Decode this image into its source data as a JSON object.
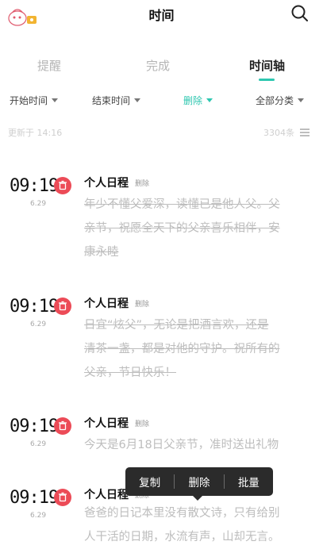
{
  "header": {
    "title": "时间",
    "search_icon": "search-icon",
    "avatar_icon": "cartoon-avatar-icon"
  },
  "tabs": [
    {
      "label": "提醒",
      "active": false
    },
    {
      "label": "完成",
      "active": false
    },
    {
      "label": "时间轴",
      "active": true
    }
  ],
  "filters": [
    {
      "label": "开始时间"
    },
    {
      "label": "结束时间"
    },
    {
      "label": "删除",
      "accent": true
    },
    {
      "label": "全部分类"
    }
  ],
  "status": {
    "updated": "更新于 14:16",
    "count": "3304条",
    "list_icon": "list-icon"
  },
  "entries": [
    {
      "time": "09:19",
      "date": "6.29",
      "category": "个人日程",
      "tag": "删除",
      "lines": [
        "年少不懂父爱深，读懂已是他人父。父",
        "亲节，祝愿全天下的父亲喜乐相伴，安",
        "康永睦"
      ],
      "struck": true
    },
    {
      "time": "09:19",
      "date": "6.29",
      "category": "个人日程",
      "tag": "删除",
      "lines": [
        "日宜“炫父”，无论是把酒言欢，还是",
        "清茶一盏，都是对他的守护。祝所有的",
        "父亲，节日快乐！"
      ],
      "struck": true
    },
    {
      "time": "09:19",
      "date": "6.29",
      "category": "个人日程",
      "tag": "删除",
      "lines": [
        "今天是6月18日父亲节，准时送出礼物"
      ],
      "struck": false
    },
    {
      "time": "09:19",
      "date": "6.29",
      "category": "个人日程",
      "tag": "删除",
      "lines": [
        "爸爸的日记本里没有散文诗，只有给别",
        "人干活的日期，水流有声，山却无言。"
      ],
      "struck": false
    }
  ],
  "context_menu": {
    "items": [
      "复制",
      "删除",
      "批量"
    ]
  },
  "colors": {
    "accent": "#2ec7b0",
    "delete_red": "#ec4b57",
    "menu_bg": "#2b2b2b"
  }
}
